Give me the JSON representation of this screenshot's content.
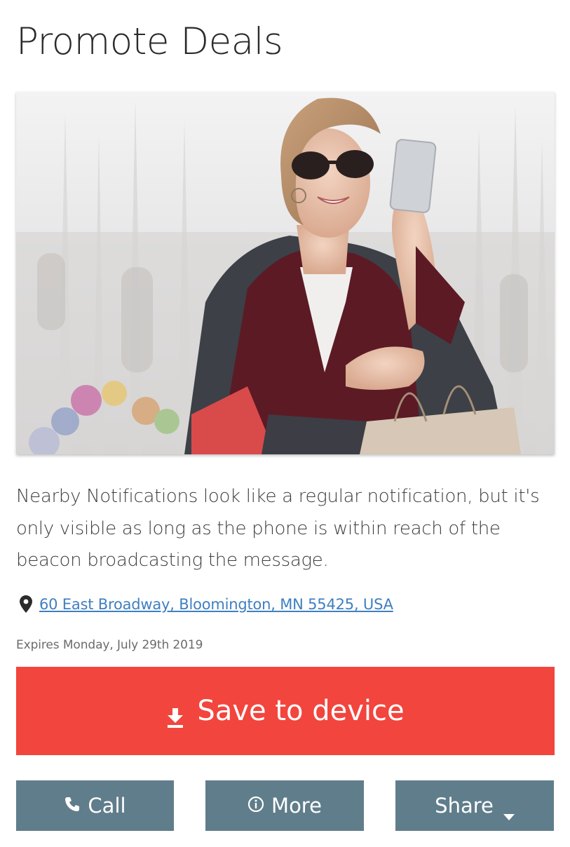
{
  "page": {
    "title": "Promote Deals"
  },
  "deal": {
    "image_icon": "woman-shopping-photo",
    "description": "Nearby Notifications look like a regular notification, but it's only visible as long as the phone is within reach of the beacon broadcasting the message.",
    "address": "60 East Broadway, Bloomington, MN 55425, USA",
    "expires": "Expires Monday, July 29th 2019"
  },
  "actions": {
    "save_label": "Save to device",
    "call_label": "Call",
    "more_label": "More",
    "share_label": "Share"
  },
  "icons": {
    "pin": "map-pin-icon",
    "download": "download-icon",
    "phone": "phone-icon",
    "info": "info-icon",
    "caret": "caret-down-icon"
  },
  "colors": {
    "primary_red": "#f2453d",
    "secondary_slate": "#607d8b",
    "link_blue": "#3f7fc0"
  }
}
